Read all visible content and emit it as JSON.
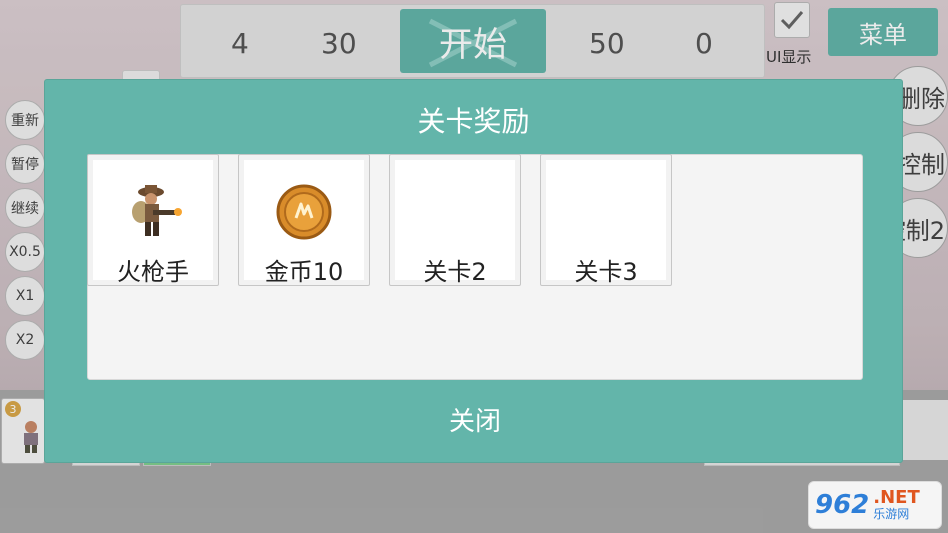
{
  "topbar": {
    "numbers": [
      "4",
      "30",
      "50",
      "0"
    ],
    "start_label": "开始"
  },
  "ui_toggle": {
    "label": "UI显示",
    "checked": true
  },
  "menu_label": "菜单",
  "right_buttons": [
    "删除",
    "控制",
    "控制2"
  ],
  "left_buttons": [
    "重新",
    "暂停",
    "继续",
    "X0.5",
    "X1",
    "X2"
  ],
  "unit_badge": "3",
  "dialog": {
    "title": "关卡奖励",
    "rewards": [
      {
        "label": "火枪手",
        "icon": "musketeer-icon"
      },
      {
        "label": "金币10",
        "icon": "gold-coin-icon"
      },
      {
        "label": "关卡2",
        "icon": ""
      },
      {
        "label": "关卡3",
        "icon": ""
      }
    ],
    "close_label": "关闭"
  },
  "watermark": {
    "number": "962",
    "suffix": ".NET",
    "subtitle": "乐游网"
  },
  "colors": {
    "teal": "#63b5aa",
    "panel": "#f4f4f4",
    "coin": "#d98c2a"
  }
}
